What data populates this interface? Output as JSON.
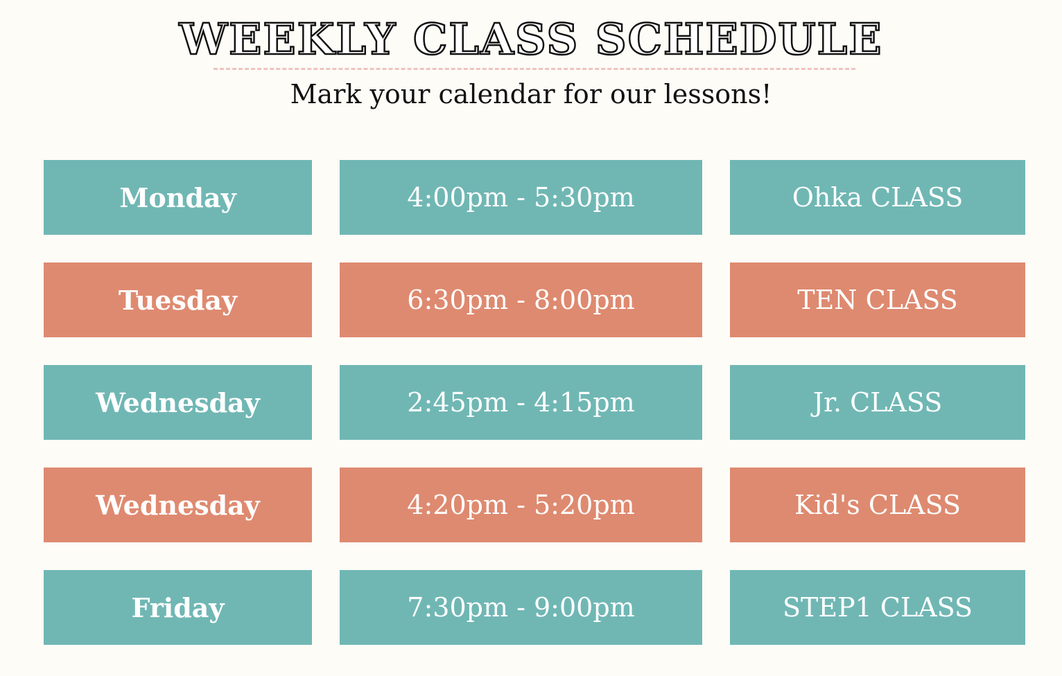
{
  "page": {
    "title": "WEEKLY CLASS SCHEDULE",
    "subtitle": "Mark your calendar for our lessons!"
  },
  "colors": {
    "teal": "#70b7b4",
    "coral": "#de8a70",
    "background": "#fdfcf7",
    "rule": "#efc4c0"
  },
  "schedule": [
    {
      "day": "Monday",
      "time": "4:00pm - 5:30pm",
      "class": "Ohka CLASS",
      "color": "#70b7b4"
    },
    {
      "day": "Tuesday",
      "time": "6:30pm - 8:00pm",
      "class": "TEN CLASS",
      "color": "#de8a70"
    },
    {
      "day": "Wednesday",
      "time": "2:45pm - 4:15pm",
      "class": "Jr. CLASS",
      "color": "#70b7b4"
    },
    {
      "day": "Wednesday",
      "time": "4:20pm - 5:20pm",
      "class": "Kid's CLASS",
      "color": "#de8a70"
    },
    {
      "day": "Friday",
      "time": "7:30pm - 9:00pm",
      "class": "STEP1 CLASS",
      "color": "#70b7b4"
    }
  ]
}
